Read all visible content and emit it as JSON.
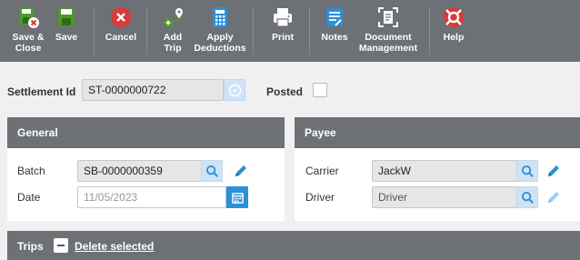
{
  "toolbar": {
    "buttons": [
      {
        "label": "Save & Close",
        "icon": "save-close-icon"
      },
      {
        "label": "Save",
        "icon": "save-icon"
      },
      {
        "label": "Cancel",
        "icon": "cancel-icon"
      },
      {
        "label": "Add Trip",
        "icon": "add-trip-icon"
      },
      {
        "label": "Apply Deductions",
        "icon": "calculator-icon"
      },
      {
        "label": "Print",
        "icon": "printer-icon"
      },
      {
        "label": "Notes",
        "icon": "notes-icon"
      },
      {
        "label": "Document Management",
        "icon": "document-management-icon"
      },
      {
        "label": "Help",
        "icon": "help-icon"
      }
    ]
  },
  "settlement": {
    "label": "Settlement Id",
    "value": "ST-0000000722",
    "posted_label": "Posted",
    "posted": false
  },
  "general": {
    "title": "General",
    "batch_label": "Batch",
    "batch_value": "SB-0000000359",
    "date_label": "Date",
    "date_value": "11/05/2023"
  },
  "payee": {
    "title": "Payee",
    "carrier_label": "Carrier",
    "carrier_value": "JackW",
    "driver_label": "Driver",
    "driver_value": "Driver"
  },
  "trips": {
    "title": "Trips",
    "delete_label": "Delete selected"
  },
  "colors": {
    "toolbar": "#6d7074",
    "accent": "#2d8fd6",
    "cancel": "#d93a3a",
    "save_green": "#4c9a2a"
  }
}
